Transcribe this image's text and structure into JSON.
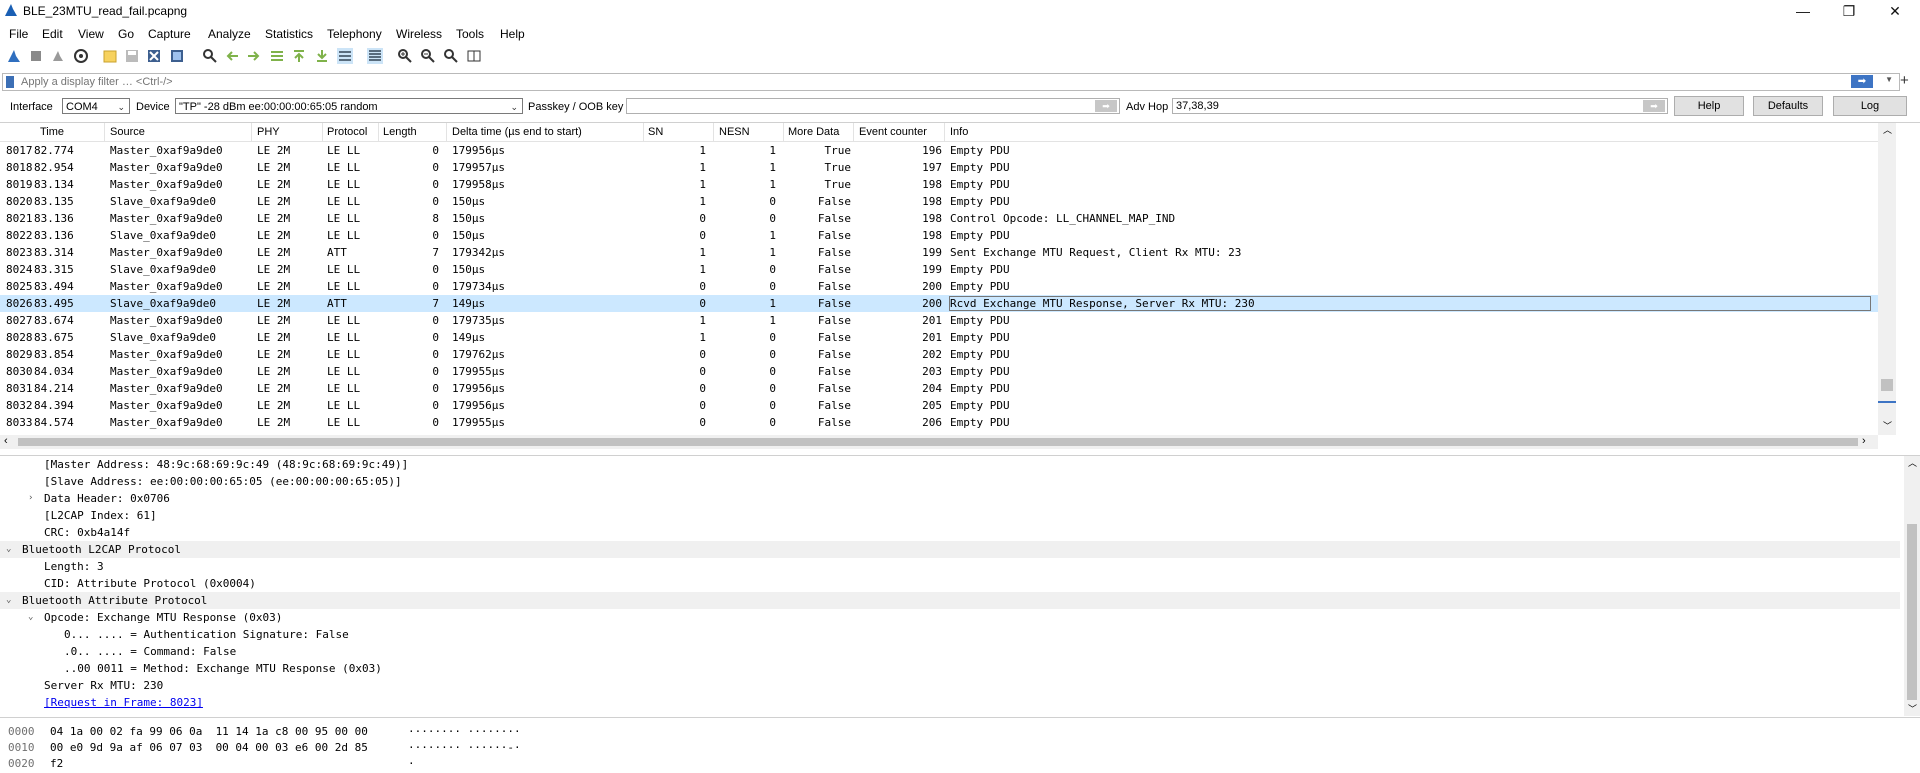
{
  "window": {
    "title": "BLE_23MTU_read_fail.pcapng",
    "minimize": "—",
    "restore": "❐",
    "close": "✕"
  },
  "menu": [
    "File",
    "Edit",
    "View",
    "Go",
    "Capture",
    "Analyze",
    "Statistics",
    "Telephony",
    "Wireless",
    "Tools",
    "Help"
  ],
  "filter": {
    "placeholder": "Apply a display filter … <Ctrl-/>",
    "apply_icon": "arrow-right-icon"
  },
  "interface_bar": {
    "interface_label": "Interface",
    "interface_value": "COM4",
    "device_label": "Device",
    "device_value": "\"TP\" -28 dBm  ee:00:00:00:65:05  random",
    "passkey_label": "Passkey / OOB key",
    "passkey_value": "",
    "advhop_label": "Adv Hop",
    "advhop_value": "37,38,39",
    "help_btn": "Help",
    "defaults_btn": "Defaults",
    "log_btn": "Log"
  },
  "packet_list": {
    "columns": [
      "Time",
      "Source",
      "PHY",
      "Protocol",
      "Length",
      "Delta time (µs end to start)",
      "SN",
      "NESN",
      "More Data",
      "Event counter",
      "Info"
    ],
    "rows": [
      {
        "no": "8017",
        "time": "82.774",
        "src": "Master_0xaf9a9de0",
        "phy": "LE 2M",
        "proto": "LE LL",
        "len": "0",
        "delta": "179956µs",
        "sn": "1",
        "nesn": "1",
        "more": "True",
        "ev": "196",
        "info": "Empty PDU"
      },
      {
        "no": "8018",
        "time": "82.954",
        "src": "Master_0xaf9a9de0",
        "phy": "LE 2M",
        "proto": "LE LL",
        "len": "0",
        "delta": "179957µs",
        "sn": "1",
        "nesn": "1",
        "more": "True",
        "ev": "197",
        "info": "Empty PDU"
      },
      {
        "no": "8019",
        "time": "83.134",
        "src": "Master_0xaf9a9de0",
        "phy": "LE 2M",
        "proto": "LE LL",
        "len": "0",
        "delta": "179958µs",
        "sn": "1",
        "nesn": "1",
        "more": "True",
        "ev": "198",
        "info": "Empty PDU"
      },
      {
        "no": "8020",
        "time": "83.135",
        "src": "Slave_0xaf9a9de0",
        "phy": "LE 2M",
        "proto": "LE LL",
        "len": "0",
        "delta": "150µs",
        "sn": "1",
        "nesn": "0",
        "more": "False",
        "ev": "198",
        "info": "Empty PDU"
      },
      {
        "no": "8021",
        "time": "83.136",
        "src": "Master_0xaf9a9de0",
        "phy": "LE 2M",
        "proto": "LE LL",
        "len": "8",
        "delta": "150µs",
        "sn": "0",
        "nesn": "0",
        "more": "False",
        "ev": "198",
        "info": "Control Opcode: LL_CHANNEL_MAP_IND"
      },
      {
        "no": "8022",
        "time": "83.136",
        "src": "Slave_0xaf9a9de0",
        "phy": "LE 2M",
        "proto": "LE LL",
        "len": "0",
        "delta": "150µs",
        "sn": "0",
        "nesn": "1",
        "more": "False",
        "ev": "198",
        "info": "Empty PDU"
      },
      {
        "no": "8023",
        "time": "83.314",
        "src": "Master_0xaf9a9de0",
        "phy": "LE 2M",
        "proto": "ATT",
        "len": "7",
        "delta": "179342µs",
        "sn": "1",
        "nesn": "1",
        "more": "False",
        "ev": "199",
        "info": "Sent Exchange MTU Request, Client Rx MTU: 23"
      },
      {
        "no": "8024",
        "time": "83.315",
        "src": "Slave_0xaf9a9de0",
        "phy": "LE 2M",
        "proto": "LE LL",
        "len": "0",
        "delta": "150µs",
        "sn": "1",
        "nesn": "0",
        "more": "False",
        "ev": "199",
        "info": "Empty PDU"
      },
      {
        "no": "8025",
        "time": "83.494",
        "src": "Master_0xaf9a9de0",
        "phy": "LE 2M",
        "proto": "LE LL",
        "len": "0",
        "delta": "179734µs",
        "sn": "0",
        "nesn": "0",
        "more": "False",
        "ev": "200",
        "info": "Empty PDU"
      },
      {
        "no": "8026",
        "time": "83.495",
        "src": "Slave_0xaf9a9de0",
        "phy": "LE 2M",
        "proto": "ATT",
        "len": "7",
        "delta": "149µs",
        "sn": "0",
        "nesn": "1",
        "more": "False",
        "ev": "200",
        "info": "Rcvd Exchange MTU Response, Server Rx MTU: 230"
      },
      {
        "no": "8027",
        "time": "83.674",
        "src": "Master_0xaf9a9de0",
        "phy": "LE 2M",
        "proto": "LE LL",
        "len": "0",
        "delta": "179735µs",
        "sn": "1",
        "nesn": "1",
        "more": "False",
        "ev": "201",
        "info": "Empty PDU"
      },
      {
        "no": "8028",
        "time": "83.675",
        "src": "Slave_0xaf9a9de0",
        "phy": "LE 2M",
        "proto": "LE LL",
        "len": "0",
        "delta": "149µs",
        "sn": "1",
        "nesn": "0",
        "more": "False",
        "ev": "201",
        "info": "Empty PDU"
      },
      {
        "no": "8029",
        "time": "83.854",
        "src": "Master_0xaf9a9de0",
        "phy": "LE 2M",
        "proto": "LE LL",
        "len": "0",
        "delta": "179762µs",
        "sn": "0",
        "nesn": "0",
        "more": "False",
        "ev": "202",
        "info": "Empty PDU"
      },
      {
        "no": "8030",
        "time": "84.034",
        "src": "Master_0xaf9a9de0",
        "phy": "LE 2M",
        "proto": "LE LL",
        "len": "0",
        "delta": "179955µs",
        "sn": "0",
        "nesn": "0",
        "more": "False",
        "ev": "203",
        "info": "Empty PDU"
      },
      {
        "no": "8031",
        "time": "84.214",
        "src": "Master_0xaf9a9de0",
        "phy": "LE 2M",
        "proto": "LE LL",
        "len": "0",
        "delta": "179956µs",
        "sn": "0",
        "nesn": "0",
        "more": "False",
        "ev": "204",
        "info": "Empty PDU"
      },
      {
        "no": "8032",
        "time": "84.394",
        "src": "Master_0xaf9a9de0",
        "phy": "LE 2M",
        "proto": "LE LL",
        "len": "0",
        "delta": "179956µs",
        "sn": "0",
        "nesn": "0",
        "more": "False",
        "ev": "205",
        "info": "Empty PDU"
      },
      {
        "no": "8033",
        "time": "84.574",
        "src": "Master_0xaf9a9de0",
        "phy": "LE 2M",
        "proto": "LE LL",
        "len": "0",
        "delta": "179955µs",
        "sn": "0",
        "nesn": "0",
        "more": "False",
        "ev": "206",
        "info": "Empty PDU"
      }
    ],
    "selected_no": "8026"
  },
  "details": [
    {
      "text": "[Master Address: 48:9c:68:69:9c:49 (48:9c:68:69:9c:49)]",
      "tog": "",
      "hdr": false
    },
    {
      "text": "[Slave Address: ee:00:00:00:65:05 (ee:00:00:00:65:05)]",
      "tog": "",
      "hdr": false
    },
    {
      "text": "Data Header: 0x0706",
      "tog": "›",
      "hdr": false
    },
    {
      "text": "[L2CAP Index: 61]",
      "tog": "",
      "hdr": false
    },
    {
      "text": "CRC: 0xb4a14f",
      "tog": "",
      "hdr": false
    },
    {
      "text": "Bluetooth L2CAP Protocol",
      "tog": "⌄",
      "hdr": true
    },
    {
      "text": "Length: 3",
      "tog": "",
      "hdr": false
    },
    {
      "text": "CID: Attribute Protocol (0x0004)",
      "tog": "",
      "hdr": false
    },
    {
      "text": "Bluetooth Attribute Protocol",
      "tog": "⌄",
      "hdr": true
    },
    {
      "text": "Opcode: Exchange MTU Response (0x03)",
      "tog": "⌄",
      "hdr": false
    },
    {
      "text": "0... .... = Authentication Signature: False",
      "tog": "",
      "hdr": false
    },
    {
      "text": ".0.. .... = Command: False",
      "tog": "",
      "hdr": false
    },
    {
      "text": "..00 0011 = Method: Exchange MTU Response (0x03)",
      "tog": "",
      "hdr": false
    },
    {
      "text": "Server Rx MTU: 230",
      "tog": "",
      "hdr": false
    },
    {
      "text": "[Request in Frame: 8023]",
      "tog": "",
      "hdr": false
    }
  ],
  "bytes": [
    {
      "off": "0000",
      "hex": "04 1a 00 02 fa 99 06 0a  11 14 1a c8 00 95 00 00",
      "ascii": "········ ········"
    },
    {
      "off": "0010",
      "hex": "00 e0 9d 9a af 06 07 03  00 04 00 03 e6 00 2d 85",
      "ascii": "········ ······-·"
    },
    {
      "off": "0020",
      "hex": "f2",
      "ascii": "·"
    }
  ]
}
